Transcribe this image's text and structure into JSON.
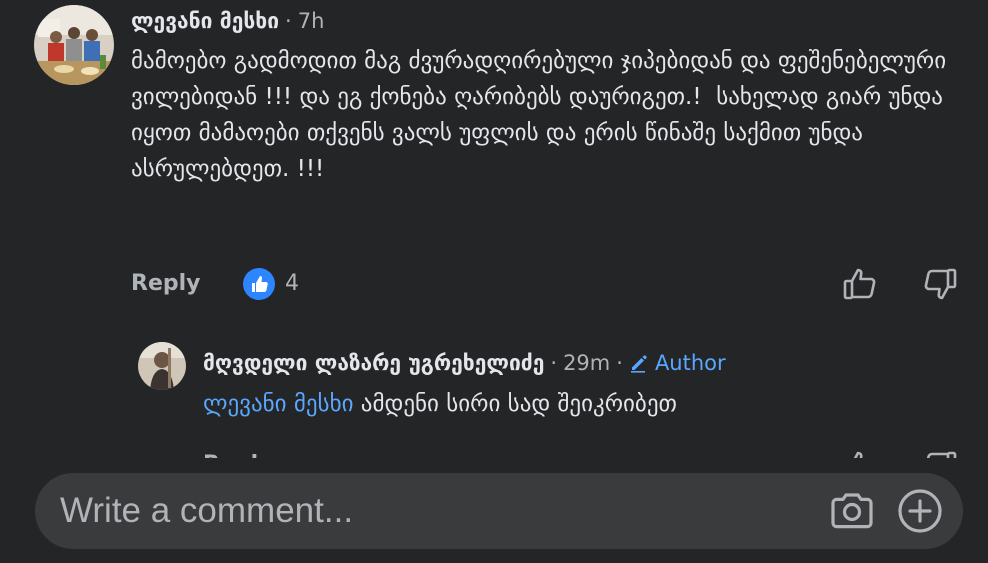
{
  "comments": [
    {
      "author": "ლევანი მესხი",
      "time": "7h",
      "text": "მამოებო გადმოდით მაგ ძვურადღირებული ჯიპებიდან და ფეშენებელური ვილებიდან !!! და ეგ ქონება ღარიბებს დაურიგეთ.!  სახელად გიარ უნდა იყოთ მამაოები თქვენს ვალს უფლის და ერის წინაშე საქმით უნდა ასრულებდეთ. !!!",
      "reply_label": "Reply",
      "reaction_count": "4"
    }
  ],
  "replies": [
    {
      "author": "მღვდელი ლაზარე უგრეხელიძე",
      "time": "29m",
      "badge": "Author",
      "mention": "ლევანი მესხი",
      "text": " ამდენი სირი სად შეიკრიბეთ",
      "reply_label": "Reply"
    }
  ],
  "separator": "·",
  "composer": {
    "placeholder": "Write a comment..."
  },
  "icons": {
    "like": "thumbs-up-icon",
    "dislike": "thumbs-down-icon",
    "camera": "camera-icon",
    "add": "plus-circle-icon",
    "author_badge": "pencil-icon",
    "reaction": "like-reaction-icon"
  },
  "colors": {
    "background": "#242526",
    "composer": "#3a3b3c",
    "text": "#e4e6eb",
    "secondary": "#b0b3b8",
    "accent": "#5aa7ff",
    "reaction": "#2d86ff"
  }
}
